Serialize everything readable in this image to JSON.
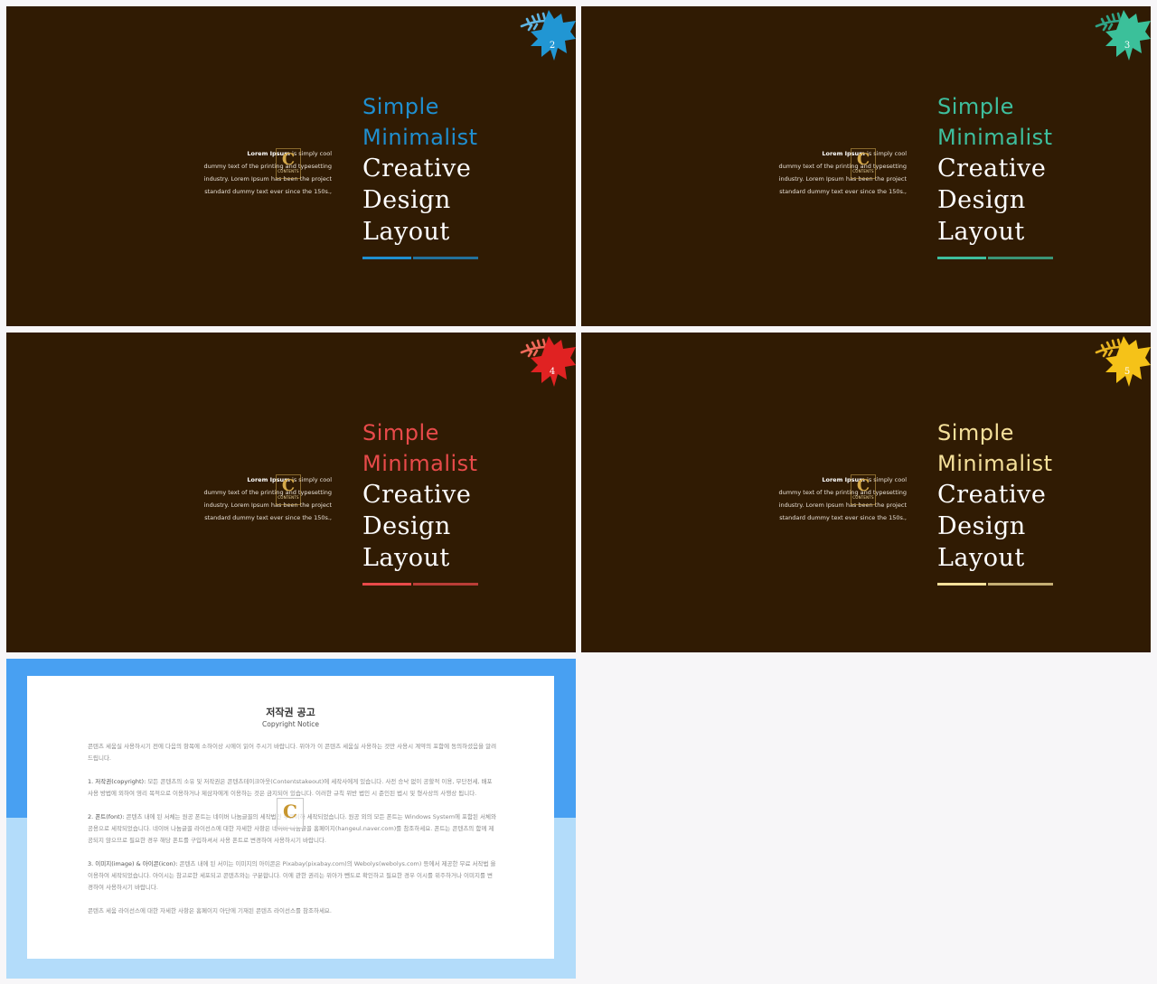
{
  "slides": [
    {
      "page_number": "2",
      "accent_color": "#1f8fd0",
      "leaf_color": "#2196d3",
      "sprig_color": "#5fb5e3"
    },
    {
      "page_number": "3",
      "accent_color": "#3ebf9e",
      "leaf_color": "#3bc09a",
      "sprig_color": "#2fa386"
    },
    {
      "page_number": "4",
      "accent_color": "#e84a4a",
      "leaf_color": "#e02222",
      "sprig_color": "#f06a5a"
    },
    {
      "page_number": "5",
      "accent_color": "#f5e09a",
      "leaf_color": "#f5c218",
      "sprig_color": "#e8b320"
    }
  ],
  "title": {
    "line1": "Simple",
    "line2": "Minimalist",
    "line3": "Creative",
    "line4": "Design",
    "line5": "Layout"
  },
  "body": {
    "bold_lead": "Lorem Ipsum",
    "rest_line1": " is simply cool",
    "line2": "dummy text of the  printing and typesetting",
    "line3": "industry. Lorem Ipsum has been the project",
    "line4": "standard dummy text ever since the 150s.,"
  },
  "logo": {
    "letter": "C",
    "word": "CONTENTS"
  },
  "notice": {
    "title": "저작권 공고",
    "subtitle": "Copyright Notice",
    "intro": "콘텐츠 세움실 사용하시기 전에 다음의 항목에 소하이상 시에이 읽어 주시기 바랍니다. 위아가 이 콘텐츠 세움실 사용하는 것만 사용시 계약의 포함에 동의하셨음을 알려드립니다.",
    "p1_label": "1. 저작권(copyright):",
    "p1_text": " 모든 콘텐츠의 소유 및 저작권은 콘텐츠테이크아웃(Contentstakeout)에 세작사에게 있습니다. 사전 승낙 없이 공할적 이용, 무단전세, 배포 사용 방법에 외하여 영리 목적으로 이용하거나 제삼자에게 이용하는 것은 금지되어 있습니다. 이러한 규칙 위반 법인 시 준인된 법시 및 형사상의 사행상 됩니다.",
    "p2_label": "2. 폰트(font):",
    "p2_text": " 콘텐츠 내에 된 서체는 원공 폰트는 네이버 나눔글꼴의 세작법인 무료이하 세작되었습니다. 원공 외의 모든 폰트는 Windows System에 포함된 서체와 공용으로 세작되었습니다. 네이버 나눔글꼴 라이선스에 대한 자세한 사항은 네이버 나눔글꼴 홈페이지(hangeul.naver.com)를 참조하세요. 폰트는 콘텐츠의 함께 제공되지 않으므로 필요한 경우 해당 폰트를 구입하셔서 사용 폰트로 변경하여 사용하시기 바랍니다.",
    "p3_label": "3. 이미지(image) & 아이콘(icon):",
    "p3_text": " 콘텐츠 내에 된 서이는 이미지의 아이콘은 Pixabay(pixabay.com)의 Webolys(webolys.com) 등에서 제공한 무료 서작법 을 이용하여 세작되었습니다. 아이시는 참고로한 세포되고 콘텐츠와는 구분합니다. 이에 관한 권리는 위아가 뺀도로 확인하고 필요한 경우 이시를 위주하거나 이미지를 변경하여 사용하시기 바랍니다.",
    "footer": "콘텐츠 세움 라이선스에 대한 자세한 사항은 홈페이지 아단에 기재된 콘텐츠 라이선스를 참조하세요."
  }
}
